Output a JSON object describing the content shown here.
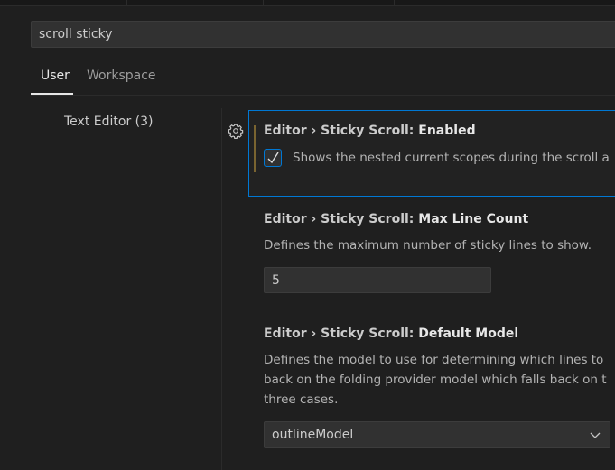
{
  "search": {
    "value": "scroll sticky"
  },
  "tabs": [
    {
      "label": "User",
      "active": true
    },
    {
      "label": "Workspace",
      "active": false
    }
  ],
  "toc": {
    "item": "Text Editor (3)"
  },
  "settings": {
    "enabled": {
      "category": "Editor › Sticky Scroll: ",
      "label": "Enabled",
      "description": "Shows the nested current scopes during the scroll a",
      "checked": true
    },
    "max_line_count": {
      "category": "Editor › Sticky Scroll: ",
      "label": "Max Line Count",
      "description": "Defines the maximum number of sticky lines to show.",
      "value": "5"
    },
    "default_model": {
      "category": "Editor › Sticky Scroll: ",
      "label": "Default Model",
      "description_lines": [
        "Defines the model to use for determining which lines to",
        "back on the folding provider model which falls back on t",
        "three cases."
      ],
      "value": "outlineModel"
    }
  },
  "colors": {
    "background": "#1f1f1f",
    "focus_border": "#0078d4",
    "modified_indicator": "#7a6430",
    "input_background": "#313131"
  },
  "icons": {
    "gear": "gear-icon",
    "checkmark": "checkmark-icon",
    "chevron": "chevron-down-icon"
  }
}
